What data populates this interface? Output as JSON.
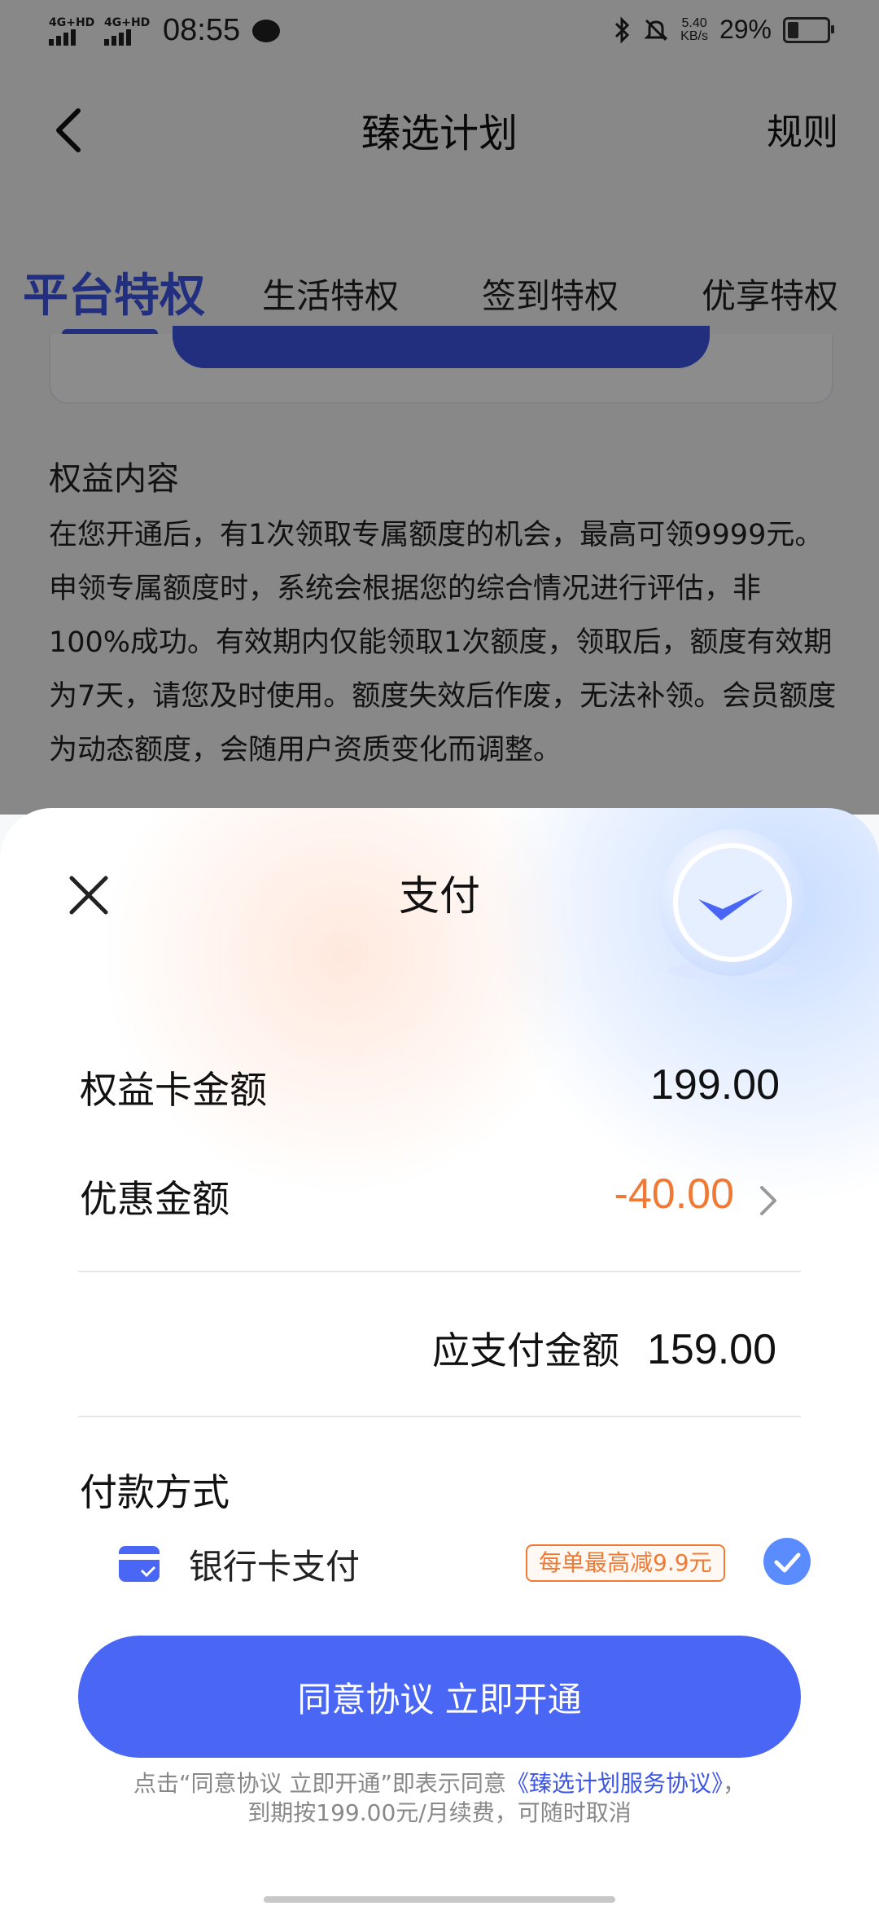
{
  "status_bar": {
    "network1": "4G+HD",
    "network2": "4G+HD",
    "time": "08:55",
    "speed_value": "5.40",
    "speed_unit": "KB/s",
    "battery": "29%",
    "battery_level": 0.29
  },
  "header": {
    "title": "臻选计划",
    "rules": "规则"
  },
  "tabs": [
    {
      "label": "平台特权",
      "active": true
    },
    {
      "label": "生活特权",
      "active": false
    },
    {
      "label": "签到特权",
      "active": false
    },
    {
      "label": "优享特权",
      "active": false
    }
  ],
  "benefits": {
    "title": "权益内容",
    "body": "在您开通后，有1次领取专属额度的机会，最高可领9999元。申领专属额度时，系统会根据您的综合情况进行评估，非100%成功。有效期内仅能领取1次额度，领取后，额度有效期为7天，请您及时使用。额度失效后作废，无法补领。会员额度为动态额度，会随用户资质变化而调整。"
  },
  "payment_sheet": {
    "title": "支付",
    "card_amount_label": "权益卡金额",
    "card_amount": "199.00",
    "discount_label": "优惠金额",
    "discount": "-40.00",
    "total_label": "应支付金额",
    "total": "159.00",
    "method_title": "付款方式",
    "method_label": "银行卡支付",
    "method_promo": "每单最高减9.9元",
    "cta": "同意协议 立即开通",
    "legal_prefix": "点击“同意协议 立即开通”即表示同意",
    "legal_link": "《臻选计划服务协议》",
    "legal_suffix": "，",
    "legal_line2": "到期按199.00元/月续费，可随时取消"
  },
  "colors": {
    "accent": "#3e56e8",
    "cta": "#4a66f5",
    "discount": "#f07a35",
    "check": "#5b8cff"
  },
  "icons": [
    "back-icon",
    "close-icon",
    "chevron-right-icon",
    "bank-card-icon",
    "check-icon",
    "verified-badge-icon",
    "chat-bubble-icon",
    "bluetooth-icon",
    "mute-icon",
    "battery-icon"
  ]
}
